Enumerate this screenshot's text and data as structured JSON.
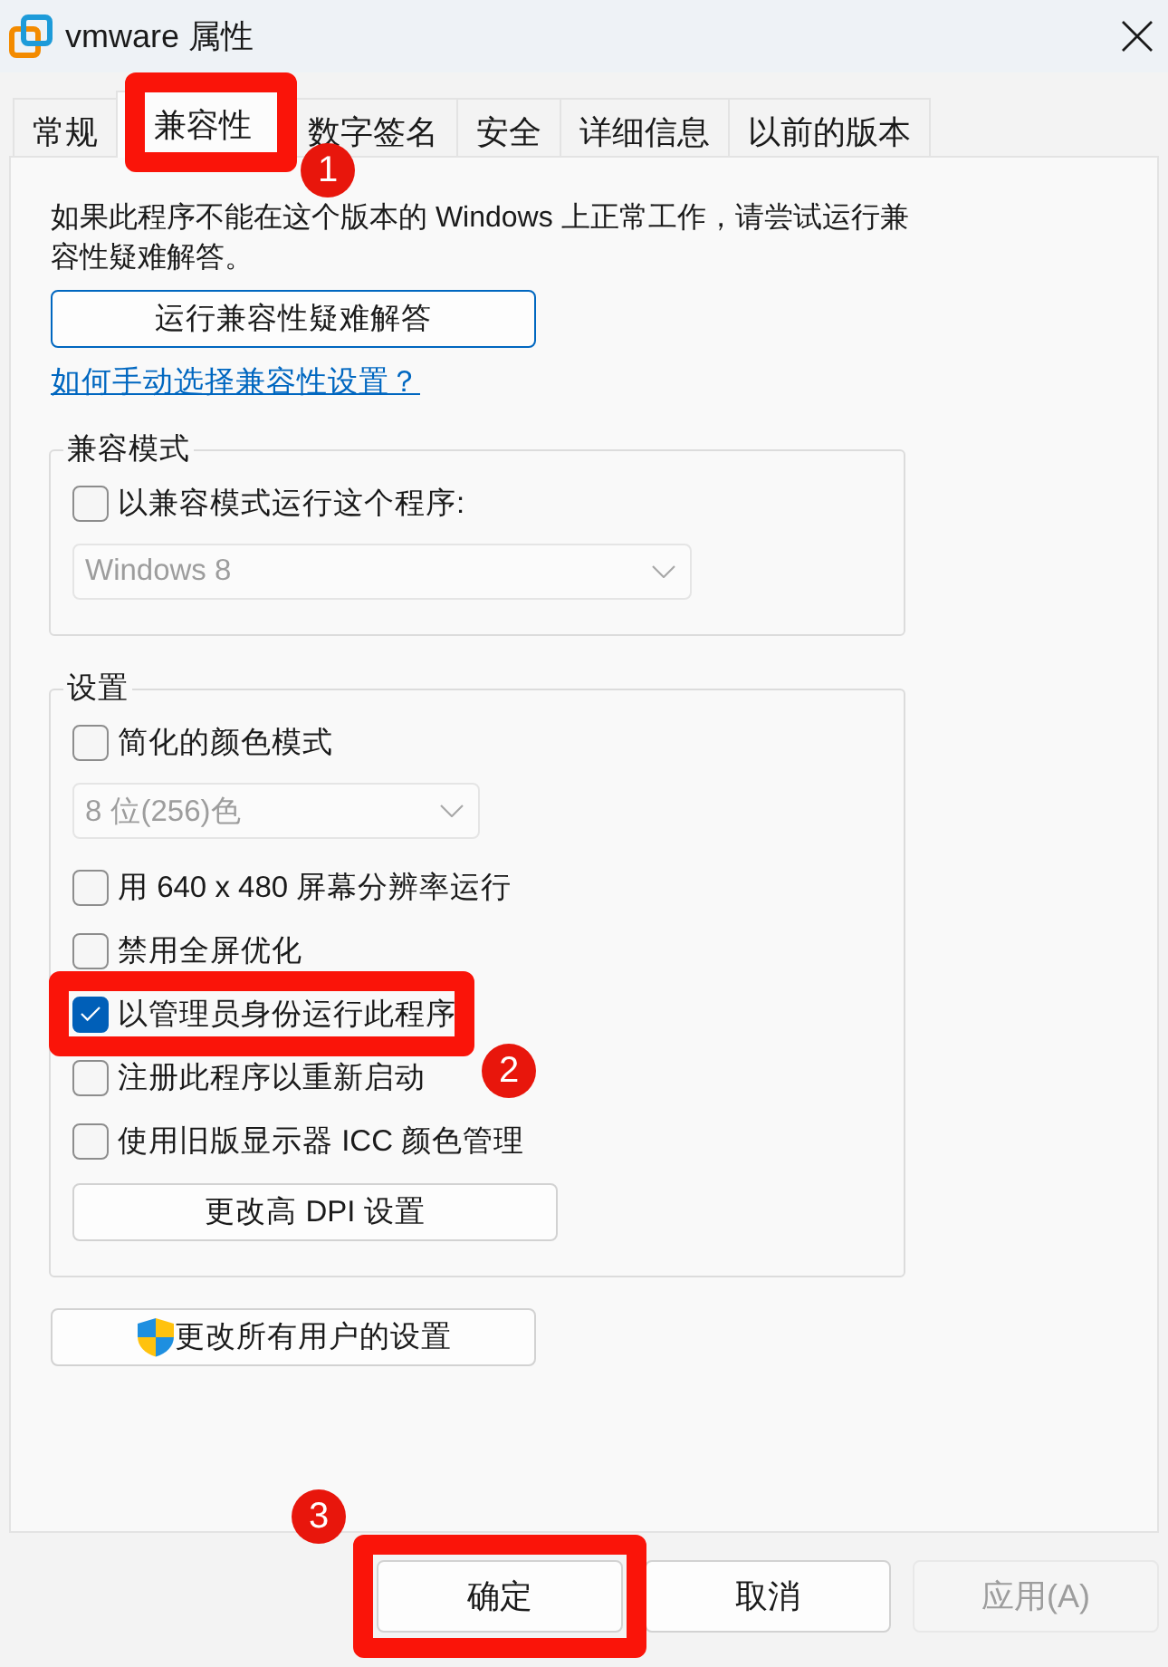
{
  "window": {
    "title": "vmware 属性"
  },
  "tabs": [
    {
      "label": "常规",
      "selected": false
    },
    {
      "label": "兼容性",
      "selected": true,
      "callout": "1"
    },
    {
      "label": "数字签名",
      "selected": false
    },
    {
      "label": "安全",
      "selected": false
    },
    {
      "label": "详细信息",
      "selected": false
    },
    {
      "label": "以前的版本",
      "selected": false
    }
  ],
  "intro": "如果此程序不能在这个版本的 Windows 上正常工作，请尝试运行兼容性疑难解答。",
  "troubleshoot_button": {
    "label": "运行兼容性疑难解答",
    "focused": true
  },
  "help_link": "如何手动选择兼容性设置？",
  "compat_mode": {
    "title": "兼容模式",
    "checkbox": {
      "label": "以兼容模式运行这个程序:",
      "checked": false
    },
    "dropdown": {
      "value": "Windows 8",
      "disabled": true
    }
  },
  "settings": {
    "title": "设置",
    "items": [
      {
        "kind": "checkbox",
        "label": "简化的颜色模式",
        "checked": false
      },
      {
        "kind": "dropdown",
        "value": "8 位(256)色",
        "disabled": true
      },
      {
        "kind": "checkbox",
        "label": "用 640 x 480 屏幕分辨率运行",
        "checked": false
      },
      {
        "kind": "checkbox",
        "label": "禁用全屏优化",
        "checked": false
      },
      {
        "kind": "checkbox",
        "label": "以管理员身份运行此程序",
        "checked": true,
        "callout": "2"
      },
      {
        "kind": "checkbox",
        "label": "注册此程序以重新启动",
        "checked": false
      },
      {
        "kind": "checkbox",
        "label": "使用旧版显示器 ICC 颜色管理",
        "checked": false
      },
      {
        "kind": "button",
        "label": "更改高 DPI 设置"
      }
    ]
  },
  "all_users_button": {
    "label": "更改所有用户的设置"
  },
  "buttons": [
    {
      "label": "确定",
      "disabled": false,
      "callout": "3"
    },
    {
      "label": "取消",
      "disabled": false
    },
    {
      "label": "应用(A)",
      "disabled": true
    }
  ]
}
